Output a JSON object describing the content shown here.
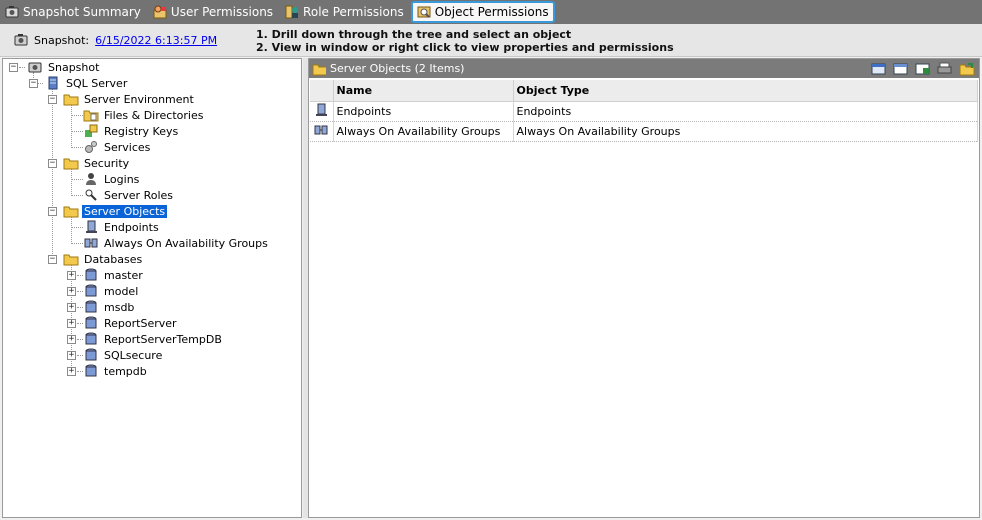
{
  "tabs": [
    {
      "label": "Snapshot Summary",
      "icon": "camera-icon"
    },
    {
      "label": "User Permissions",
      "icon": "user-permissions-icon"
    },
    {
      "label": "Role Permissions",
      "icon": "role-permissions-icon"
    },
    {
      "label": "Object Permissions",
      "icon": "object-permissions-icon",
      "active": true
    }
  ],
  "infobar": {
    "snapshot_label": "Snapshot:",
    "snapshot_date": "6/15/2022 6:13:57 PM",
    "instruction_1": "1. Drill down through the tree and select an object",
    "instruction_2": "2. View in window or right click to view properties and permissions"
  },
  "tree": {
    "snapshot": "Snapshot",
    "sql_server": "SQL Server",
    "server_environment": "Server Environment",
    "files_directories": "Files & Directories",
    "registry_keys": "Registry Keys",
    "services": "Services",
    "security": "Security",
    "logins": "Logins",
    "server_roles": "Server Roles",
    "server_objects": "Server Objects",
    "endpoints": "Endpoints",
    "availability_groups": "Always On Availability Groups",
    "databases": "Databases",
    "db_list": [
      "master",
      "model",
      "msdb",
      "ReportServer",
      "ReportServerTempDB",
      "SQLsecure",
      "tempdb"
    ]
  },
  "panel": {
    "title": "Server Objects (2 Items)",
    "columns": [
      "Name",
      "Object Type"
    ],
    "rows": [
      {
        "name": "Endpoints",
        "type": "Endpoints",
        "icon": "endpoint-icon"
      },
      {
        "name": "Always On Availability Groups",
        "type": "Always On Availability Groups",
        "icon": "availability-group-icon"
      }
    ]
  },
  "colors": {
    "tabbar": "#737373",
    "selection": "#0a64d8",
    "active_tab_border": "#3a9ad9",
    "panel_header": "#7b7b7b",
    "folder": "#f2c94c"
  }
}
